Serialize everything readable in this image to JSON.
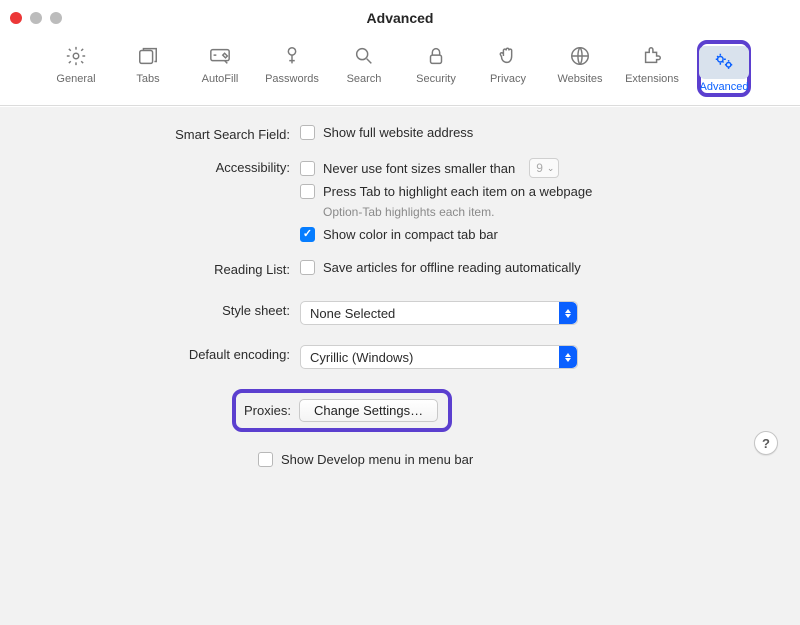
{
  "window": {
    "title": "Advanced"
  },
  "toolbar": [
    {
      "key": "general",
      "label": "General"
    },
    {
      "key": "tabs",
      "label": "Tabs"
    },
    {
      "key": "autofill",
      "label": "AutoFill"
    },
    {
      "key": "passwords",
      "label": "Passwords"
    },
    {
      "key": "search",
      "label": "Search"
    },
    {
      "key": "security",
      "label": "Security"
    },
    {
      "key": "privacy",
      "label": "Privacy"
    },
    {
      "key": "websites",
      "label": "Websites"
    },
    {
      "key": "extensions",
      "label": "Extensions"
    },
    {
      "key": "advanced",
      "label": "Advanced",
      "active": true,
      "highlighted": true
    }
  ],
  "sections": {
    "smartSearch": {
      "label": "Smart Search Field:",
      "showFullAddress": {
        "checked": false,
        "text": "Show full website address"
      }
    },
    "accessibility": {
      "label": "Accessibility:",
      "minFont": {
        "checked": false,
        "text": "Never use font sizes smaller than",
        "value": "9"
      },
      "pressTab": {
        "checked": false,
        "text": "Press Tab to highlight each item on a webpage"
      },
      "hint": "Option-Tab highlights each item.",
      "compact": {
        "checked": true,
        "text": "Show color in compact tab bar"
      }
    },
    "readingList": {
      "label": "Reading List:",
      "offline": {
        "checked": false,
        "text": "Save articles for offline reading automatically"
      }
    },
    "styleSheet": {
      "label": "Style sheet:",
      "value": "None Selected"
    },
    "encoding": {
      "label": "Default encoding:",
      "value": "Cyrillic (Windows)"
    },
    "proxies": {
      "label": "Proxies:",
      "button": "Change Settings…",
      "highlighted": true
    },
    "develop": {
      "checked": false,
      "text": "Show Develop menu in menu bar"
    }
  },
  "help": "?"
}
